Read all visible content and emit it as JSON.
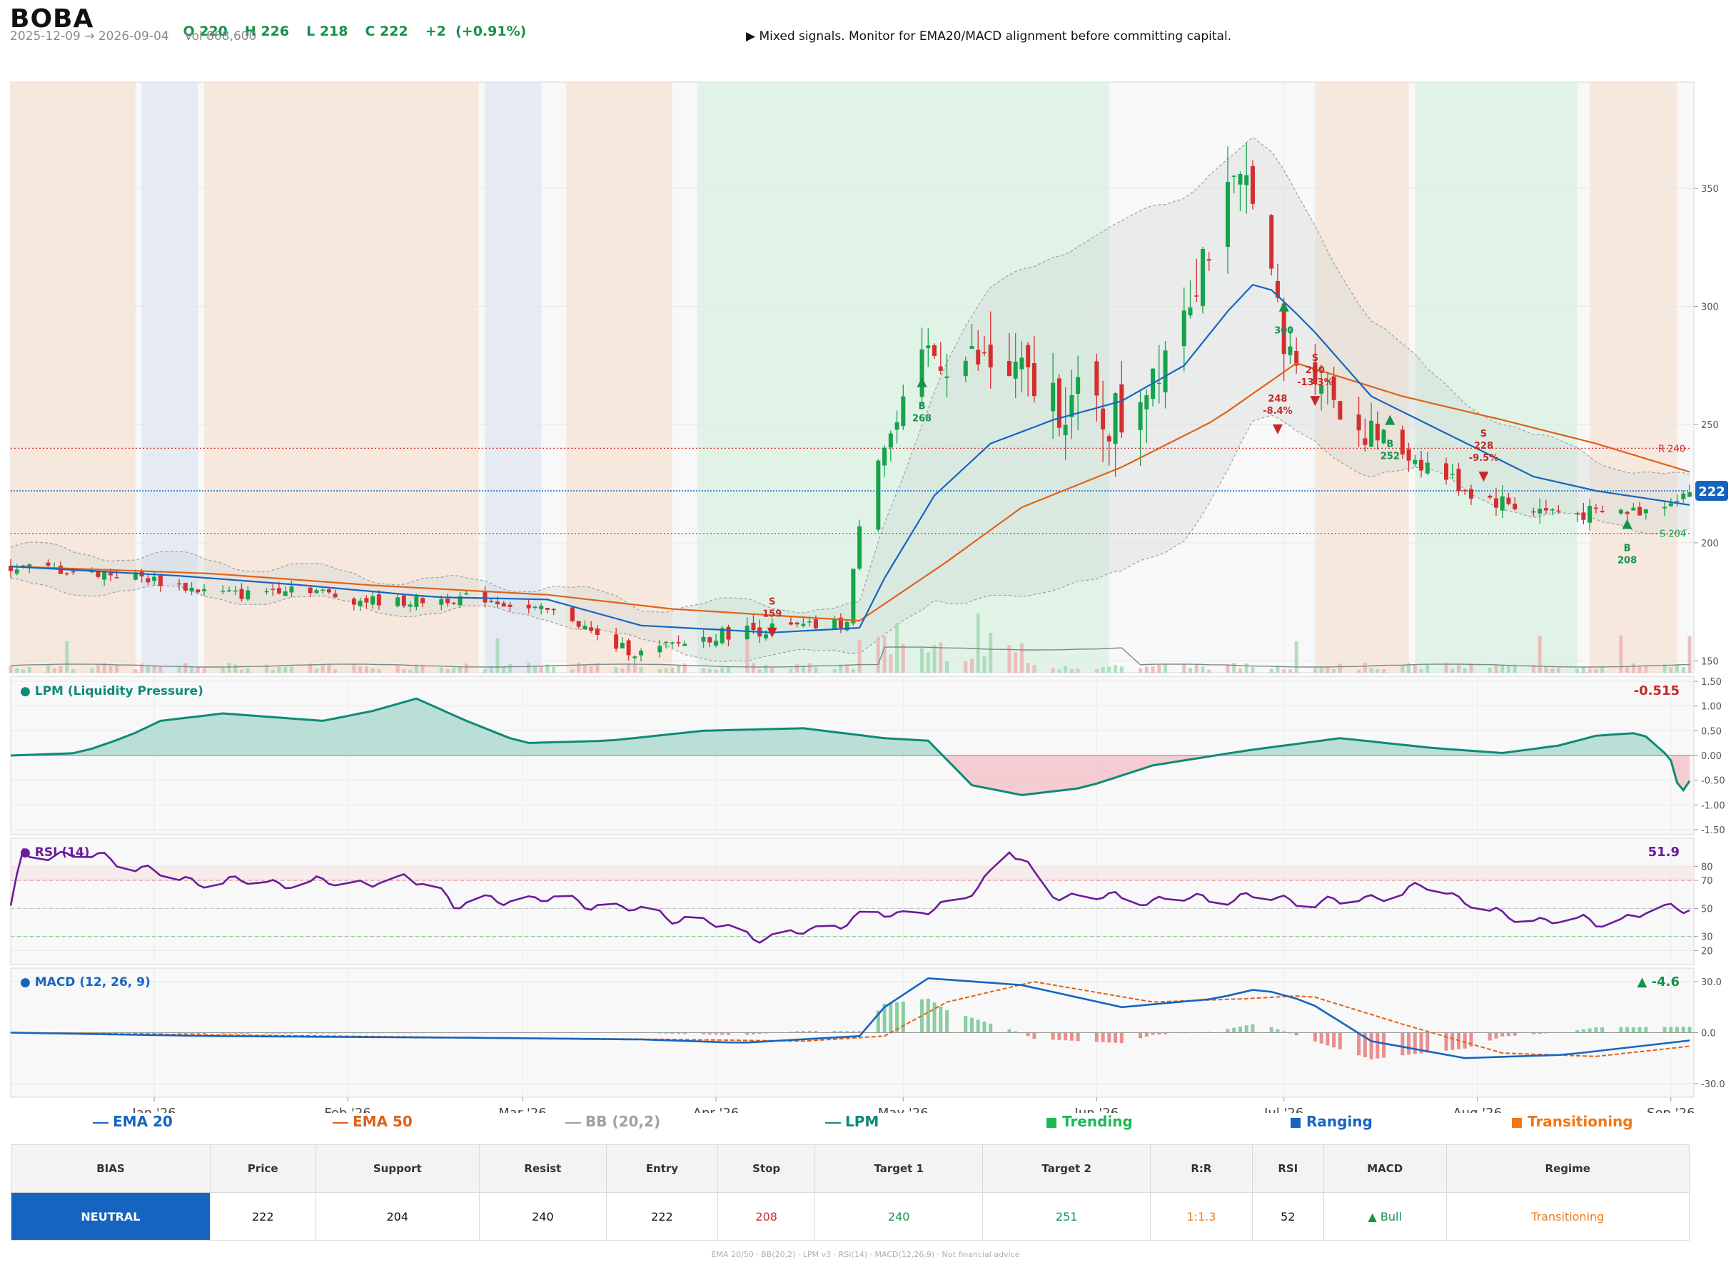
{
  "header": {
    "ticker": "BOBA",
    "ohlc": [
      {
        "label": "O 220"
      },
      {
        "label": "H 226"
      },
      {
        "label": "L 218"
      },
      {
        "label": "C 222"
      },
      {
        "label": "+2  (+0.91%)"
      }
    ],
    "date_range": "2025-12-09 → 2026-09-04",
    "volume": "Vol 868,600",
    "signal": "▶  Mixed signals. Monitor for EMA20/MACD alignment before committing capital."
  },
  "colors": {
    "up": "#16a34a",
    "down": "#d32f2f",
    "ema20": "#1565c0",
    "ema50": "#e0621a",
    "bb": "#a0a0a0",
    "lpm": "#0f8a76",
    "rsi": "#6a1b9a",
    "trending": "#1db954",
    "ranging": "#1565c0",
    "transitioning": "#f07818"
  },
  "chart_data": [
    {
      "type": "candlestick",
      "panel": "price",
      "x_range": [
        "2025-12-09",
        "2026-09-04"
      ],
      "ylim": [
        145,
        395
      ],
      "yticks": [
        150,
        200,
        250,
        300,
        350
      ],
      "xticks": [
        {
          "date": "2026-01-01",
          "label": "Jan '26"
        },
        {
          "date": "2026-02-01",
          "label": "Feb '26"
        },
        {
          "date": "2026-03-01",
          "label": "Mar '26"
        },
        {
          "date": "2026-04-01",
          "label": "Apr '26"
        },
        {
          "date": "2026-05-01",
          "label": "May '26"
        },
        {
          "date": "2026-06-01",
          "label": "Jun '26"
        },
        {
          "date": "2026-07-01",
          "label": "Jul '26"
        },
        {
          "date": "2026-08-01",
          "label": "Aug '26"
        },
        {
          "date": "2026-09-01",
          "label": "Sep '26"
        }
      ],
      "last_price_label": "222",
      "resistance": {
        "value": 240,
        "label": "R 240"
      },
      "support": {
        "value": 204,
        "label": "S 204"
      },
      "regimes": [
        {
          "start": "2025-12-09",
          "end": "2025-12-29",
          "regime": "transitioning"
        },
        {
          "start": "2025-12-30",
          "end": "2026-01-08",
          "regime": "ranging"
        },
        {
          "start": "2026-01-09",
          "end": "2026-02-22",
          "regime": "transitioning"
        },
        {
          "start": "2026-02-23",
          "end": "2026-03-04",
          "regime": "ranging"
        },
        {
          "start": "2026-03-08",
          "end": "2026-03-25",
          "regime": "transitioning"
        },
        {
          "start": "2026-03-29",
          "end": "2026-06-03",
          "regime": "trending"
        },
        {
          "start": "2026-07-06",
          "end": "2026-07-21",
          "regime": "transitioning"
        },
        {
          "start": "2026-07-22",
          "end": "2026-08-17",
          "regime": "trending"
        },
        {
          "start": "2026-08-19",
          "end": "2026-09-02",
          "regime": "transitioning"
        }
      ],
      "trades": [
        {
          "date": "2026-04-10",
          "side": "S",
          "lines": [
            "S",
            "159"
          ],
          "price": 162
        },
        {
          "date": "2026-05-04",
          "side": "B",
          "lines": [
            "B",
            "268"
          ],
          "price": 268
        },
        {
          "date": "2026-06-30",
          "side": "S",
          "lines": [
            "248",
            "-8.4%"
          ],
          "price": 248
        },
        {
          "date": "2026-07-01",
          "side": "B",
          "lines": [
            "300"
          ],
          "price": 300
        },
        {
          "date": "2026-07-06",
          "side": "S",
          "lines": [
            "S",
            "260",
            "-13.3%"
          ],
          "price": 260
        },
        {
          "date": "2026-07-18",
          "side": "B",
          "lines": [
            "B",
            "252"
          ],
          "price": 252
        },
        {
          "date": "2026-08-02",
          "side": "S",
          "lines": [
            "S",
            "228",
            "-9.5%"
          ],
          "price": 228
        },
        {
          "date": "2026-08-25",
          "side": "B",
          "lines": [
            "B",
            "208"
          ],
          "price": 208
        }
      ],
      "close_anchors": [
        [
          "2025-12-09",
          190
        ],
        [
          "2025-12-20",
          188
        ],
        [
          "2025-12-29",
          186
        ],
        [
          "2026-01-08",
          180
        ],
        [
          "2026-01-15",
          178
        ],
        [
          "2026-01-24",
          182
        ],
        [
          "2026-02-01",
          176
        ],
        [
          "2026-02-10",
          175
        ],
        [
          "2026-02-22",
          177
        ],
        [
          "2026-03-02",
          172
        ],
        [
          "2026-03-08",
          170
        ],
        [
          "2026-03-14",
          158
        ],
        [
          "2026-03-20",
          153
        ],
        [
          "2026-03-27",
          158
        ],
        [
          "2026-04-05",
          163
        ],
        [
          "2026-04-15",
          164
        ],
        [
          "2026-04-22",
          166
        ],
        [
          "2026-04-25",
          230
        ],
        [
          "2026-04-30",
          250
        ],
        [
          "2026-05-05",
          280
        ],
        [
          "2026-05-15",
          275
        ],
        [
          "2026-05-25",
          262
        ],
        [
          "2026-06-05",
          252
        ],
        [
          "2026-06-12",
          285
        ],
        [
          "2026-06-20",
          335
        ],
        [
          "2026-06-26",
          355
        ],
        [
          "2026-07-01",
          280
        ],
        [
          "2026-07-06",
          275
        ],
        [
          "2026-07-12",
          250
        ],
        [
          "2026-07-22",
          236
        ],
        [
          "2026-08-01",
          220
        ],
        [
          "2026-08-10",
          214
        ],
        [
          "2026-08-20",
          212
        ],
        [
          "2026-08-28",
          214
        ],
        [
          "2026-09-04",
          222
        ]
      ],
      "ema20_anchors": [
        [
          "2025-12-09",
          190
        ],
        [
          "2026-01-05",
          186
        ],
        [
          "2026-01-25",
          182
        ],
        [
          "2026-02-15",
          177
        ],
        [
          "2026-03-05",
          176
        ],
        [
          "2026-03-20",
          165
        ],
        [
          "2026-04-10",
          162
        ],
        [
          "2026-04-24",
          164
        ],
        [
          "2026-04-28",
          185
        ],
        [
          "2026-05-06",
          220
        ],
        [
          "2026-05-15",
          242
        ],
        [
          "2026-05-25",
          252
        ],
        [
          "2026-06-05",
          260
        ],
        [
          "2026-06-15",
          275
        ],
        [
          "2026-06-22",
          298
        ],
        [
          "2026-06-27",
          312
        ],
        [
          "2026-07-05",
          292
        ],
        [
          "2026-07-15",
          262
        ],
        [
          "2026-07-28",
          245
        ],
        [
          "2026-08-10",
          228
        ],
        [
          "2026-08-20",
          222
        ],
        [
          "2026-09-04",
          216
        ]
      ],
      "ema50_anchors": [
        [
          "2025-12-09",
          190
        ],
        [
          "2026-01-10",
          187
        ],
        [
          "2026-02-05",
          182
        ],
        [
          "2026-03-05",
          178
        ],
        [
          "2026-03-25",
          172
        ],
        [
          "2026-04-24",
          167
        ],
        [
          "2026-05-08",
          192
        ],
        [
          "2026-05-20",
          215
        ],
        [
          "2026-06-05",
          232
        ],
        [
          "2026-06-20",
          252
        ],
        [
          "2026-07-03",
          276
        ],
        [
          "2026-07-20",
          262
        ],
        [
          "2026-08-05",
          252
        ],
        [
          "2026-08-20",
          242
        ],
        [
          "2026-09-04",
          230
        ]
      ],
      "bb_width_anchors": [
        [
          "2025-12-09",
          8
        ],
        [
          "2026-03-05",
          6
        ],
        [
          "2026-04-10",
          12
        ],
        [
          "2026-04-24",
          8
        ],
        [
          "2026-05-10",
          60
        ],
        [
          "2026-06-01",
          75
        ],
        [
          "2026-06-20",
          70
        ],
        [
          "2026-07-06",
          45
        ],
        [
          "2026-07-25",
          20
        ],
        [
          "2026-08-20",
          14
        ],
        [
          "2026-09-04",
          10
        ]
      ]
    },
    {
      "type": "area",
      "panel": "lpm",
      "title": "● LPM (Liquidity Pressure)",
      "last_value": "-0.515",
      "ylim": [
        -1.6,
        1.6
      ],
      "yticks": [
        -1.5,
        -1.0,
        -0.5,
        0.0,
        0.5,
        1.0,
        1.5
      ],
      "anchors": [
        [
          "2025-12-09",
          0.0
        ],
        [
          "2025-12-20",
          0.05
        ],
        [
          "2025-12-28",
          0.4
        ],
        [
          "2026-01-02",
          0.7
        ],
        [
          "2026-01-12",
          0.85
        ],
        [
          "2026-01-28",
          0.7
        ],
        [
          "2026-02-05",
          0.9
        ],
        [
          "2026-02-12",
          1.15
        ],
        [
          "2026-02-20",
          0.7
        ],
        [
          "2026-03-01",
          0.25
        ],
        [
          "2026-03-15",
          0.3
        ],
        [
          "2026-03-30",
          0.5
        ],
        [
          "2026-04-15",
          0.55
        ],
        [
          "2026-04-28",
          0.35
        ],
        [
          "2026-05-05",
          0.3
        ],
        [
          "2026-05-12",
          -0.6
        ],
        [
          "2026-05-20",
          -0.8
        ],
        [
          "2026-05-30",
          -0.65
        ],
        [
          "2026-06-10",
          -0.2
        ],
        [
          "2026-06-25",
          0.1
        ],
        [
          "2026-07-10",
          0.35
        ],
        [
          "2026-07-25",
          0.15
        ],
        [
          "2026-08-05",
          0.05
        ],
        [
          "2026-08-14",
          0.2
        ],
        [
          "2026-08-20",
          0.4
        ],
        [
          "2026-08-26",
          0.45
        ],
        [
          "2026-08-29",
          0.35
        ],
        [
          "2026-09-01",
          -0.1
        ],
        [
          "2026-09-02",
          -0.55
        ],
        [
          "2026-09-03",
          -0.7
        ],
        [
          "2026-09-04",
          -0.515
        ]
      ]
    },
    {
      "type": "line",
      "panel": "rsi",
      "title": "● RSI (14)",
      "last_value": "51.9",
      "ylim": [
        10,
        100
      ],
      "yticks": [
        20,
        30,
        50,
        70,
        80
      ],
      "overbought": 70,
      "oversold": 30,
      "anchors": [
        [
          "2025-12-09",
          50
        ],
        [
          "2025-12-11",
          90
        ],
        [
          "2025-12-25",
          86
        ],
        [
          "2026-01-05",
          70
        ],
        [
          "2026-01-25",
          68
        ],
        [
          "2026-02-15",
          70
        ],
        [
          "2026-02-18",
          52
        ],
        [
          "2026-03-01",
          58
        ],
        [
          "2026-03-15",
          52
        ],
        [
          "2026-03-30",
          40
        ],
        [
          "2026-04-10",
          28
        ],
        [
          "2026-04-25",
          44
        ],
        [
          "2026-05-10",
          52
        ],
        [
          "2026-05-18",
          92
        ],
        [
          "2026-05-25",
          60
        ],
        [
          "2026-06-10",
          56
        ],
        [
          "2026-06-25",
          58
        ],
        [
          "2026-07-10",
          54
        ],
        [
          "2026-07-25",
          66
        ],
        [
          "2026-08-05",
          44
        ],
        [
          "2026-08-20",
          40
        ],
        [
          "2026-09-04",
          51.9
        ]
      ]
    },
    {
      "type": "line",
      "panel": "macd",
      "title": "● MACD (12, 26, 9)",
      "last_value": "▲ -4.6",
      "ylim": [
        -38,
        38
      ],
      "yticks": [
        -30.0,
        0.0,
        30.0
      ],
      "macd_anchors": [
        [
          "2025-12-09",
          0
        ],
        [
          "2026-01-10",
          -2
        ],
        [
          "2026-02-20",
          -3
        ],
        [
          "2026-03-20",
          -4
        ],
        [
          "2026-04-05",
          -6
        ],
        [
          "2026-04-24",
          -2
        ],
        [
          "2026-04-28",
          15
        ],
        [
          "2026-05-05",
          32
        ],
        [
          "2026-05-20",
          28
        ],
        [
          "2026-06-05",
          15
        ],
        [
          "2026-06-20",
          20
        ],
        [
          "2026-06-27",
          26
        ],
        [
          "2026-07-05",
          18
        ],
        [
          "2026-07-15",
          -5
        ],
        [
          "2026-07-30",
          -15
        ],
        [
          "2026-08-15",
          -13
        ],
        [
          "2026-09-04",
          -4.6
        ]
      ],
      "signal_anchors": [
        [
          "2025-12-09",
          0
        ],
        [
          "2026-01-15",
          -1.5
        ],
        [
          "2026-02-25",
          -3
        ],
        [
          "2026-03-25",
          -4
        ],
        [
          "2026-04-15",
          -5
        ],
        [
          "2026-04-28",
          -2
        ],
        [
          "2026-05-08",
          18
        ],
        [
          "2026-05-22",
          30
        ],
        [
          "2026-06-10",
          18
        ],
        [
          "2026-06-25",
          20
        ],
        [
          "2026-07-05",
          22
        ],
        [
          "2026-07-20",
          5
        ],
        [
          "2026-08-05",
          -12
        ],
        [
          "2026-08-20",
          -14
        ],
        [
          "2026-09-04",
          -8
        ]
      ]
    }
  ],
  "legend": [
    {
      "label": "EMA 20",
      "color": "#1565c0",
      "kind": "line"
    },
    {
      "label": "EMA 50",
      "color": "#e0621a",
      "kind": "line"
    },
    {
      "label": "BB (20,2)",
      "color": "#a0a0a0",
      "kind": "line"
    },
    {
      "label": "LPM",
      "color": "#0f8a76",
      "kind": "line"
    },
    {
      "label": "Trending",
      "color": "#1db954",
      "kind": "square"
    },
    {
      "label": "Ranging",
      "color": "#1565c0",
      "kind": "square"
    },
    {
      "label": "Transitioning",
      "color": "#f07818",
      "kind": "square"
    }
  ],
  "summary": {
    "headers": [
      "BIAS",
      "Price",
      "Support",
      "Resist",
      "Entry",
      "Stop",
      "Target 1",
      "Target 2",
      "R:R",
      "RSI",
      "MACD",
      "Regime"
    ],
    "values": [
      "NEUTRAL",
      "222",
      "204",
      "240",
      "222",
      "208",
      "240",
      "251",
      "1:1.3",
      "52",
      "▲ Bull",
      "Transitioning"
    ],
    "value_colors": [
      "#ffffff",
      "#111111",
      "#111111",
      "#111111",
      "#111111",
      "#d32f2f",
      "#15924c",
      "#0f8a76",
      "#e67e22",
      "#111111",
      "#15924c",
      "#e67e22"
    ]
  },
  "footer": "EMA 20/50  ·  BB(20,2)  ·  LPM v3  ·  RSI(14)  ·  MACD(12,26,9)  ·  Not financial advice"
}
